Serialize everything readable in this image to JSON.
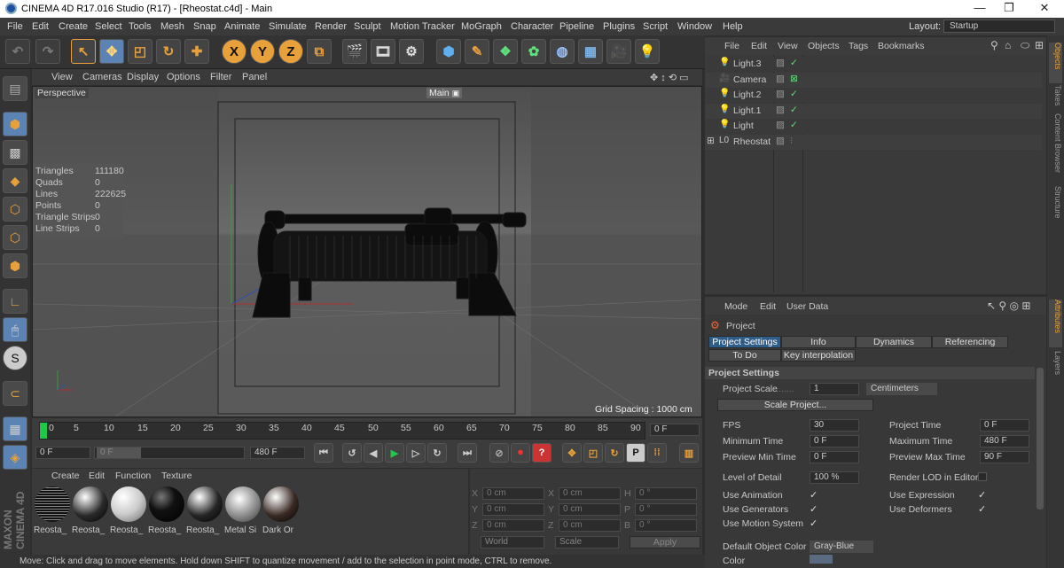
{
  "window": {
    "title": "CINEMA 4D R17.016 Studio (R17) - [Rheostat.c4d] - Main",
    "controls": [
      "—",
      "❐",
      "✕"
    ]
  },
  "menubar": {
    "items": [
      "File",
      "Edit",
      "Create",
      "Select",
      "Tools",
      "Mesh",
      "Snap",
      "Animate",
      "Simulate",
      "Render",
      "Sculpt",
      "Motion Tracker",
      "MoGraph",
      "Character",
      "Pipeline",
      "Plugins",
      "Script",
      "Window",
      "Help"
    ],
    "layout_label": "Layout:",
    "layout_value": "Startup"
  },
  "toolbar": {
    "axis_x": "X",
    "axis_y": "Y",
    "axis_z": "Z"
  },
  "viewport": {
    "menu": [
      "View",
      "Cameras",
      "Display",
      "Options",
      "Filter",
      "Panel"
    ],
    "label": "Perspective",
    "camera_tag": "Main",
    "stats": [
      {
        "k": "Triangles",
        "v": "111180"
      },
      {
        "k": "Quads",
        "v": "0"
      },
      {
        "k": "Lines",
        "v": "222625"
      },
      {
        "k": "Points",
        "v": "0"
      },
      {
        "k": "Triangle Strips",
        "v": "0"
      },
      {
        "k": "Line Strips",
        "v": "0"
      }
    ],
    "grid_spacing": "Grid Spacing : 1000 cm"
  },
  "timeline": {
    "ticks": [
      "0",
      "5",
      "10",
      "15",
      "20",
      "25",
      "30",
      "35",
      "40",
      "45",
      "50",
      "55",
      "60",
      "65",
      "70",
      "75",
      "80",
      "85",
      "90"
    ],
    "current_frame": "0 F",
    "start": "0 F",
    "min": "0 F",
    "end": "480 F"
  },
  "materials": {
    "menu": [
      "Create",
      "Edit",
      "Function",
      "Texture"
    ],
    "items": [
      {
        "name": "Reosta_",
        "color": "#1a1a1a",
        "type": "stripe"
      },
      {
        "name": "Reosta_",
        "color": "#2a2a2a",
        "type": "dark"
      },
      {
        "name": "Reosta_",
        "color": "#d8d8d8",
        "type": "light"
      },
      {
        "name": "Reosta_",
        "color": "#151515",
        "type": "black"
      },
      {
        "name": "Reosta_",
        "color": "#252525",
        "type": "dark"
      },
      {
        "name": "Metal Si",
        "color": "#bcbcbc",
        "type": "metal"
      },
      {
        "name": "Dark Or",
        "color": "#3a2a24",
        "type": "brown"
      }
    ]
  },
  "coords": {
    "rows": [
      {
        "a": "X",
        "av": "0 cm",
        "b": "X",
        "bv": "0 cm",
        "c": "H",
        "cv": "0 °"
      },
      {
        "a": "Y",
        "av": "0 cm",
        "b": "Y",
        "bv": "0 cm",
        "c": "P",
        "cv": "0 °"
      },
      {
        "a": "Z",
        "av": "0 cm",
        "b": "Z",
        "bv": "0 cm",
        "c": "B",
        "cv": "0 °"
      }
    ],
    "mode1": "World",
    "mode2": "Scale",
    "apply": "Apply"
  },
  "objects": {
    "menu": [
      "File",
      "Edit",
      "View",
      "Objects",
      "Tags",
      "Bookmarks"
    ],
    "items": [
      {
        "name": "Light.3",
        "icon": "light"
      },
      {
        "name": "Camera",
        "icon": "camera"
      },
      {
        "name": "Light.2",
        "icon": "light"
      },
      {
        "name": "Light.1",
        "icon": "light"
      },
      {
        "name": "Light",
        "icon": "light"
      },
      {
        "name": "Rheostat",
        "icon": "null"
      }
    ]
  },
  "attributes": {
    "menu": [
      "Mode",
      "Edit",
      "User Data"
    ],
    "object_name": "Project",
    "tabs_row1": [
      "Project Settings",
      "Info",
      "Dynamics",
      "Referencing"
    ],
    "tabs_row2": [
      "To Do",
      "Key interpolation"
    ],
    "section": "Project Settings",
    "project_scale_label": "Project Scale",
    "project_scale_value": "1",
    "project_scale_unit": "Centimeters",
    "scale_project_button": "Scale Project...",
    "left_fields": [
      {
        "label": "FPS",
        "value": "30"
      },
      {
        "label": "Minimum Time",
        "value": "0 F"
      },
      {
        "label": "Preview Min Time",
        "value": "0 F"
      }
    ],
    "right_fields": [
      {
        "label": "Project Time",
        "value": "0 F"
      },
      {
        "label": "Maximum Time",
        "value": "480 F"
      },
      {
        "label": "Preview Max Time",
        "value": "90 F"
      }
    ],
    "lod_label": "Level of Detail",
    "lod_value": "100 %",
    "render_lod_label": "Render LOD in Editor",
    "checks_left": [
      "Use Animation",
      "Use Generators",
      "Use Motion System"
    ],
    "checks_right": [
      "Use Expression",
      "Use Deformers"
    ],
    "default_color_label": "Default Object Color",
    "default_color_value": "Gray-Blue",
    "color_label": "Color"
  },
  "sidetabs": [
    "Objects",
    "Takes",
    "Content Browser",
    "Structure",
    "Attributes",
    "Layers"
  ],
  "status": "Move: Click and drag to move elements. Hold down SHIFT to quantize movement / add to the selection in point mode, CTRL to remove.",
  "colors": {
    "accent": "#e8a13a",
    "selection": "#2e5d8a",
    "highlight": "#4a7ab0"
  }
}
